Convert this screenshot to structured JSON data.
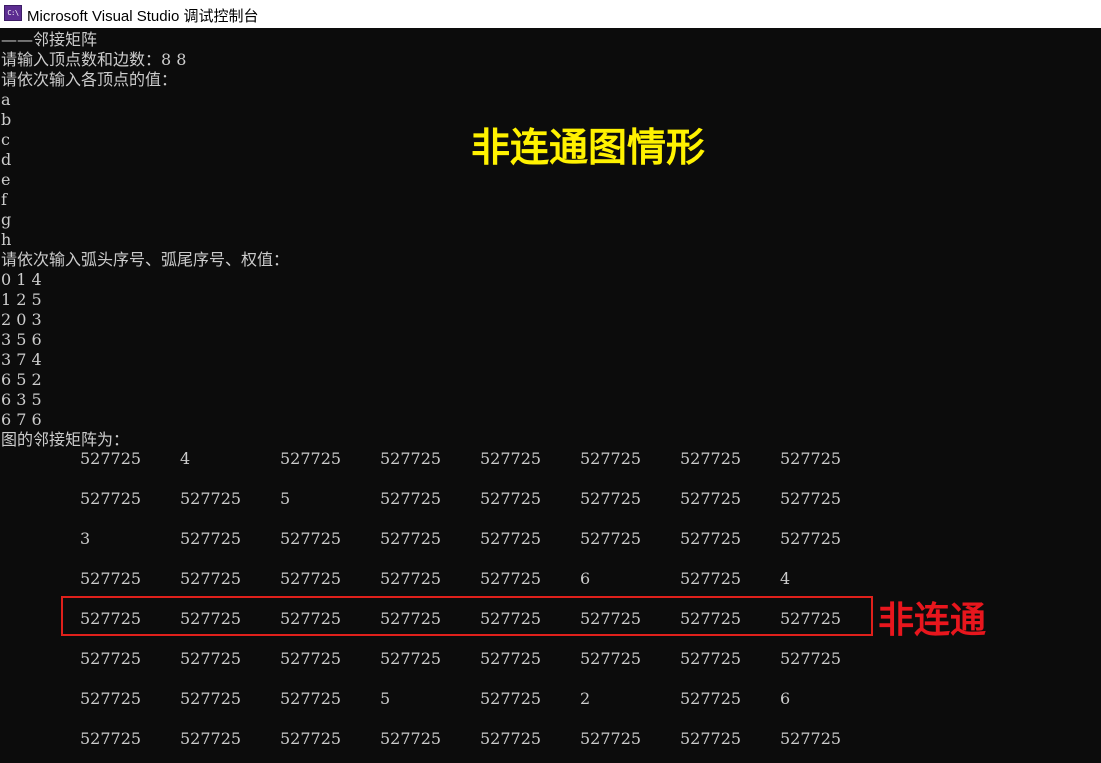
{
  "window": {
    "title": "Microsoft Visual Studio 调试控制台",
    "icon": "visual-studio-console-icon",
    "icon_text": "C:\\"
  },
  "console": {
    "lines": [
      "——邻接矩阵",
      "请输入顶点数和边数：8 8",
      "请依次输入各顶点的值：",
      "a",
      "b",
      "c",
      "d",
      "e",
      "f",
      "g",
      "h",
      "请依次输入弧头序号、弧尾序号、权值：",
      "0 1 4",
      "1 2 5",
      "2 0 3",
      "3 5 6",
      "3 7 4",
      "6 5 2",
      "6 3 5",
      "6 7 6",
      "图的邻接矩阵为："
    ],
    "matrix": [
      [
        "527725",
        "4",
        "527725",
        "527725",
        "527725",
        "527725",
        "527725",
        "527725"
      ],
      [
        "527725",
        "527725",
        "5",
        "527725",
        "527725",
        "527725",
        "527725",
        "527725"
      ],
      [
        "3",
        "527725",
        "527725",
        "527725",
        "527725",
        "527725",
        "527725",
        "527725"
      ],
      [
        "527725",
        "527725",
        "527725",
        "527725",
        "527725",
        "6",
        "527725",
        "4"
      ],
      [
        "527725",
        "527725",
        "527725",
        "527725",
        "527725",
        "527725",
        "527725",
        "527725"
      ],
      [
        "527725",
        "527725",
        "527725",
        "527725",
        "527725",
        "527725",
        "527725",
        "527725"
      ],
      [
        "527725",
        "527725",
        "527725",
        "5",
        "527725",
        "2",
        "527725",
        "6"
      ],
      [
        "527725",
        "527725",
        "527725",
        "527725",
        "527725",
        "527725",
        "527725",
        "527725"
      ]
    ],
    "highlighted_row": 4
  },
  "annotations": {
    "heading": "非连通图情形",
    "heading_color": "#fff200",
    "row_note": "非连通",
    "row_note_color": "#e8161d",
    "box_color": "#e0201b"
  },
  "colors": {
    "console_bg": "#0c0c0c",
    "console_text": "#cccccc",
    "titlebar_bg": "#ffffff"
  }
}
